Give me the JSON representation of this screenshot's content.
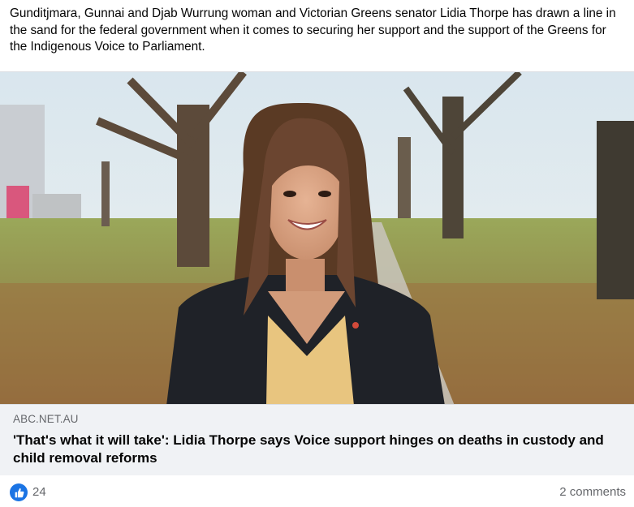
{
  "post": {
    "text": "Gunditjmara, Gunnai and Djab Wurrung woman and Victorian Greens senator Lidia Thorpe has drawn a line in the sand for the federal government when it comes to securing her support and the support of the Greens for the Indigenous Voice to Parliament."
  },
  "link": {
    "image_icon": "portrait-photo",
    "domain": "ABC.NET.AU",
    "headline": "'That's what it will take': Lidia Thorpe says Voice support hinges on deaths in custody and child removal reforms"
  },
  "reactions": {
    "icon": "thumbs-up-icon",
    "accent": "#1b74e4",
    "like_count": "24",
    "comments": "2 comments"
  }
}
